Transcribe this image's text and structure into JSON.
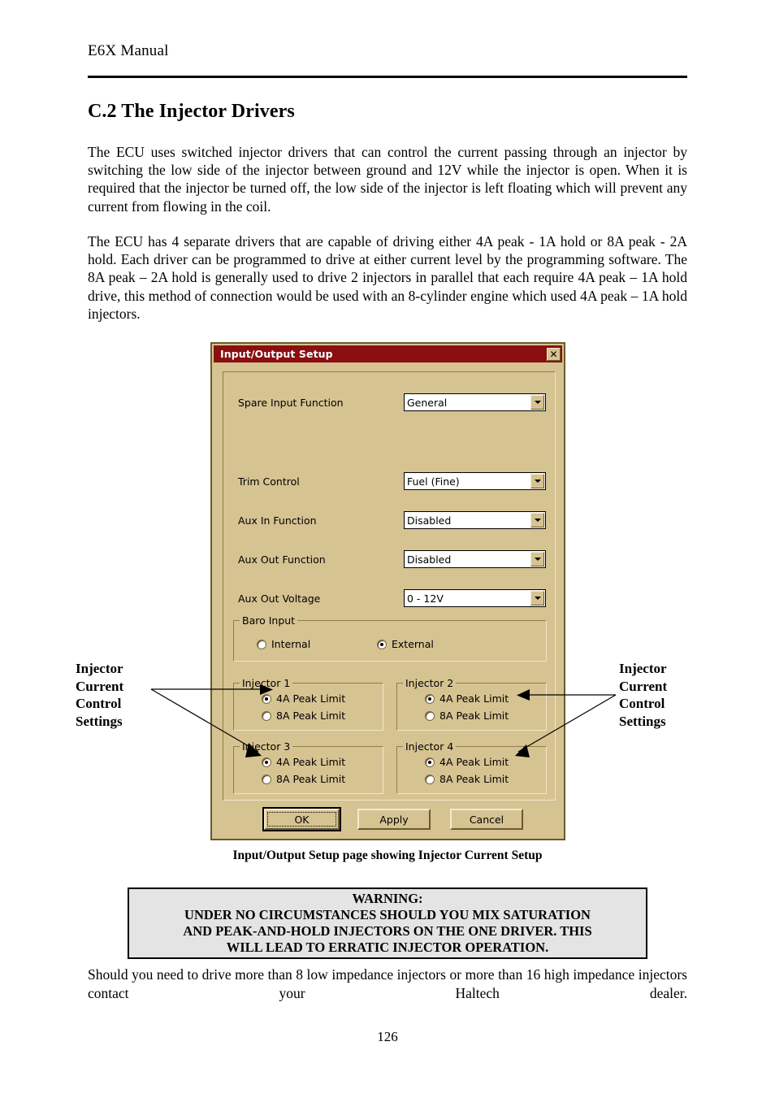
{
  "header": {
    "title": "E6X Manual"
  },
  "section": {
    "title": "C.2 The Injector Drivers"
  },
  "paragraphs": {
    "p1": "The ECU uses switched injector drivers that can control the current passing through an injector by switching the low side of the injector between ground and 12V while the injector is open.  When it is required that the injector be turned off, the low side of the injector is left floating which will prevent any current from flowing in the coil.",
    "p2": "The ECU has 4 separate drivers that are capable of driving either 4A peak - 1A hold or 8A peak - 2A hold.  Each driver can be programmed to drive at either current level by the programming software.  The 8A peak – 2A hold is generally used to drive 2 injectors in parallel that each require 4A peak – 1A hold drive, this method of connection would be used with an 8-cylinder engine which used 4A peak – 1A hold injectors.",
    "p3": "Should you need to drive more than 8 low impedance injectors or more than 16 high impedance injectors contact your Haltech dealer."
  },
  "dialog": {
    "title": "Input/Output Setup",
    "close_label": "✕",
    "fields": [
      {
        "label": "Spare Input Function",
        "value": "General"
      },
      {
        "label": "Trim Control",
        "value": "Fuel (Fine)"
      },
      {
        "label": "Aux In Function",
        "value": "Disabled"
      },
      {
        "label": "Aux Out Function",
        "value": "Disabled"
      },
      {
        "label": "Aux Out Voltage",
        "value": "0 - 12V"
      }
    ],
    "baro": {
      "title": "Baro Input",
      "options": [
        {
          "label": "Internal",
          "selected": false
        },
        {
          "label": "External",
          "selected": true
        }
      ]
    },
    "injectors": [
      {
        "title": "Injector 1",
        "options": [
          {
            "label": "4A Peak Limit",
            "selected": true
          },
          {
            "label": "8A Peak Limit",
            "selected": false
          }
        ]
      },
      {
        "title": "Injector 2",
        "options": [
          {
            "label": "4A Peak Limit",
            "selected": true
          },
          {
            "label": "8A Peak Limit",
            "selected": false
          }
        ]
      },
      {
        "title": "Injector 3",
        "options": [
          {
            "label": "4A Peak Limit",
            "selected": true
          },
          {
            "label": "8A Peak Limit",
            "selected": false
          }
        ]
      },
      {
        "title": "Injector 4",
        "options": [
          {
            "label": "4A Peak Limit",
            "selected": true
          },
          {
            "label": "8A Peak Limit",
            "selected": false
          }
        ]
      }
    ],
    "buttons": [
      {
        "label": "OK",
        "default": true
      },
      {
        "label": "Apply",
        "default": false
      },
      {
        "label": "Cancel",
        "default": false
      }
    ],
    "colors": {
      "titlebar": "#8a0f10",
      "face": "#d6c392",
      "field": "#ffffff"
    }
  },
  "annotations": {
    "left": "Injector Current Control Settings",
    "right": "Injector Current Control Settings"
  },
  "caption": "Input/Output Setup page showing Injector Current Setup",
  "warning": {
    "lines": [
      "WARNING:",
      "UNDER NO CIRCUMSTANCES SHOULD YOU MIX SATURATION",
      "AND PEAK-AND-HOLD INJECTORS ON THE ONE DRIVER. THIS",
      "WILL LEAD TO ERRATIC INJECTOR OPERATION."
    ]
  },
  "page_number": "126"
}
